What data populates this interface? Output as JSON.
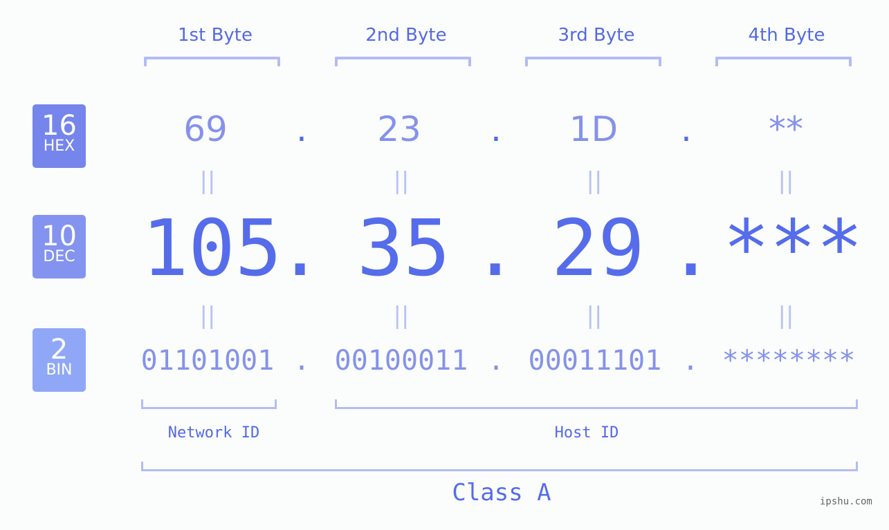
{
  "byte_headers": [
    "1st Byte",
    "2nd Byte",
    "3rd Byte",
    "4th Byte"
  ],
  "badges": {
    "hex": {
      "base": "16",
      "label": "HEX",
      "color": "#7585eb"
    },
    "dec": {
      "base": "10",
      "label": "DEC",
      "color": "#8493ef"
    },
    "bin": {
      "base": "2",
      "label": "BIN",
      "color": "#90a7f8"
    }
  },
  "hex": [
    "69",
    "23",
    "1D",
    "**"
  ],
  "dec": [
    "105",
    "35",
    "29",
    "***"
  ],
  "bin": [
    "01101001",
    "00100011",
    "00011101",
    "********"
  ],
  "separator": ".",
  "equals": "||",
  "network_id_label": "Network ID",
  "host_id_label": "Host ID",
  "class_label": "Class A",
  "watermark": "ipshu.com",
  "colors": {
    "accent": "#556ceb",
    "light": "#8592eb",
    "bracket": "#b3bcf5",
    "background": "#fbfdfc"
  }
}
